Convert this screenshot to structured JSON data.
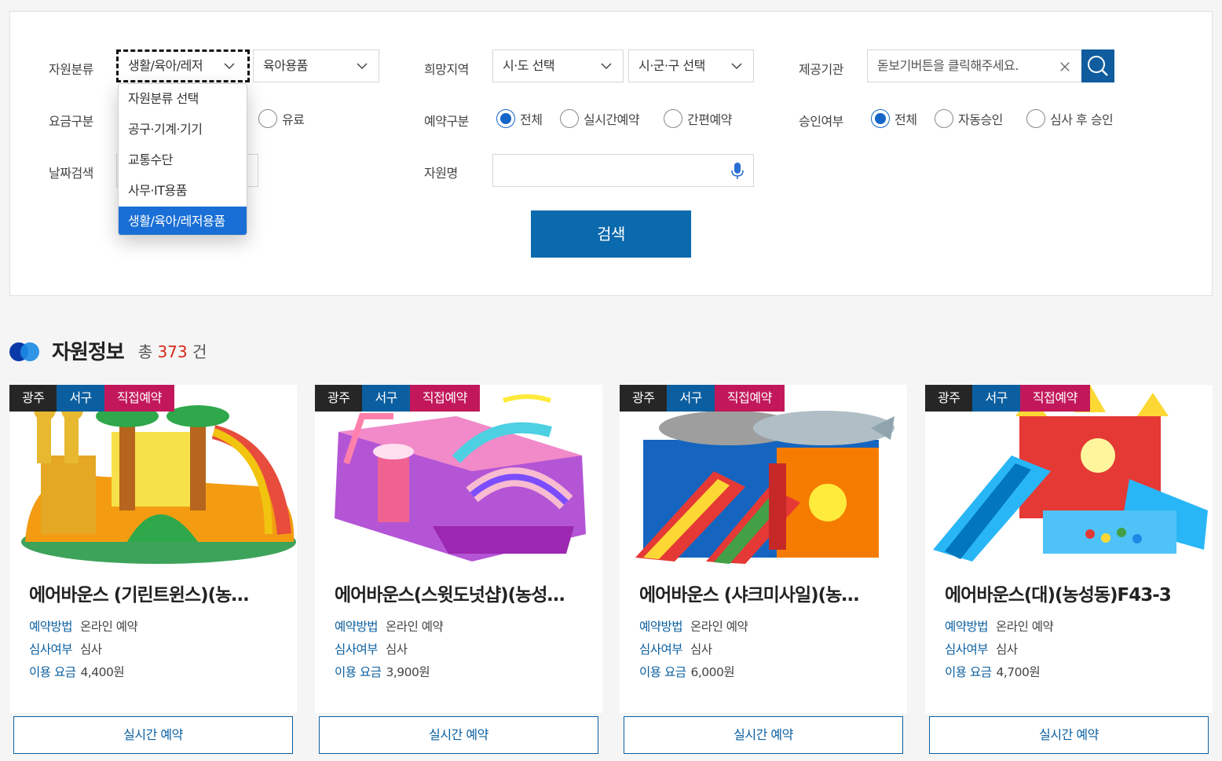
{
  "filters": {
    "category_label": "자원분류",
    "category_value": "생활/육아/레저",
    "subcategory_value": "육아용품",
    "region_label": "희망지역",
    "sido_value": "시·도 선택",
    "sigungu_value": "시·군·구 선택",
    "provider_label": "제공기관",
    "provider_placeholder": "돋보기버튼을 클릭해주세요.",
    "fee_label": "요금구분",
    "fee_paid": "유료",
    "reserve_type_label": "예약구분",
    "reserve_all": "전체",
    "reserve_realtime": "실시간예약",
    "reserve_simple": "간편예약",
    "approval_label": "승인여부",
    "approval_all": "전체",
    "approval_auto": "자동승인",
    "approval_review": "심사 후 승인",
    "date_label": "날짜검색",
    "name_label": "자원명",
    "search_button": "검색"
  },
  "dropdown": {
    "items": [
      "자원분류 선택",
      "공구·기계·기기",
      "교통수단",
      "사무·IT용품",
      "생활/육아/레저용품"
    ],
    "selected_index": 4
  },
  "section": {
    "title": "자원정보",
    "count_prefix": "총",
    "count": "373",
    "count_suffix": "건"
  },
  "cards": [
    {
      "tag1": "광주",
      "tag2": "서구",
      "tag3": "직접예약",
      "name": "에어바운스 (기린트윈스)(농…",
      "method_k": "예약방법",
      "method_v": "온라인 예약",
      "review_k": "심사여부",
      "review_v": "심사",
      "fee_k": "이용 요금",
      "fee_v": "4,400원",
      "button": "실시간 예약"
    },
    {
      "tag1": "광주",
      "tag2": "서구",
      "tag3": "직접예약",
      "name": "에어바운스(스윗도넛샵)(농성…",
      "method_k": "예약방법",
      "method_v": "온라인 예약",
      "review_k": "심사여부",
      "review_v": "심사",
      "fee_k": "이용 요금",
      "fee_v": "3,900원",
      "button": "실시간 예약"
    },
    {
      "tag1": "광주",
      "tag2": "서구",
      "tag3": "직접예약",
      "name": "에어바운스 (샤크미사일)(농…",
      "method_k": "예약방법",
      "method_v": "온라인 예약",
      "review_k": "심사여부",
      "review_v": "심사",
      "fee_k": "이용 요금",
      "fee_v": "6,000원",
      "button": "실시간 예약"
    },
    {
      "tag1": "광주",
      "tag2": "서구",
      "tag3": "직접예약",
      "name": "에어바운스(대)(농성동)F43-3",
      "method_k": "예약방법",
      "method_v": "온라인 예약",
      "review_k": "심사여부",
      "review_v": "심사",
      "fee_k": "이용 요금",
      "fee_v": "4,700원",
      "button": "실시간 예약"
    }
  ],
  "colors": {
    "primary": "#0b69ad",
    "accent_tag": "#c2185b",
    "selected_option": "#1a6fd6",
    "count_red": "#d6281e"
  },
  "icons": [
    "chevron-down-icon",
    "close-icon",
    "search-icon",
    "microphone-icon",
    "section-dots-icon"
  ]
}
